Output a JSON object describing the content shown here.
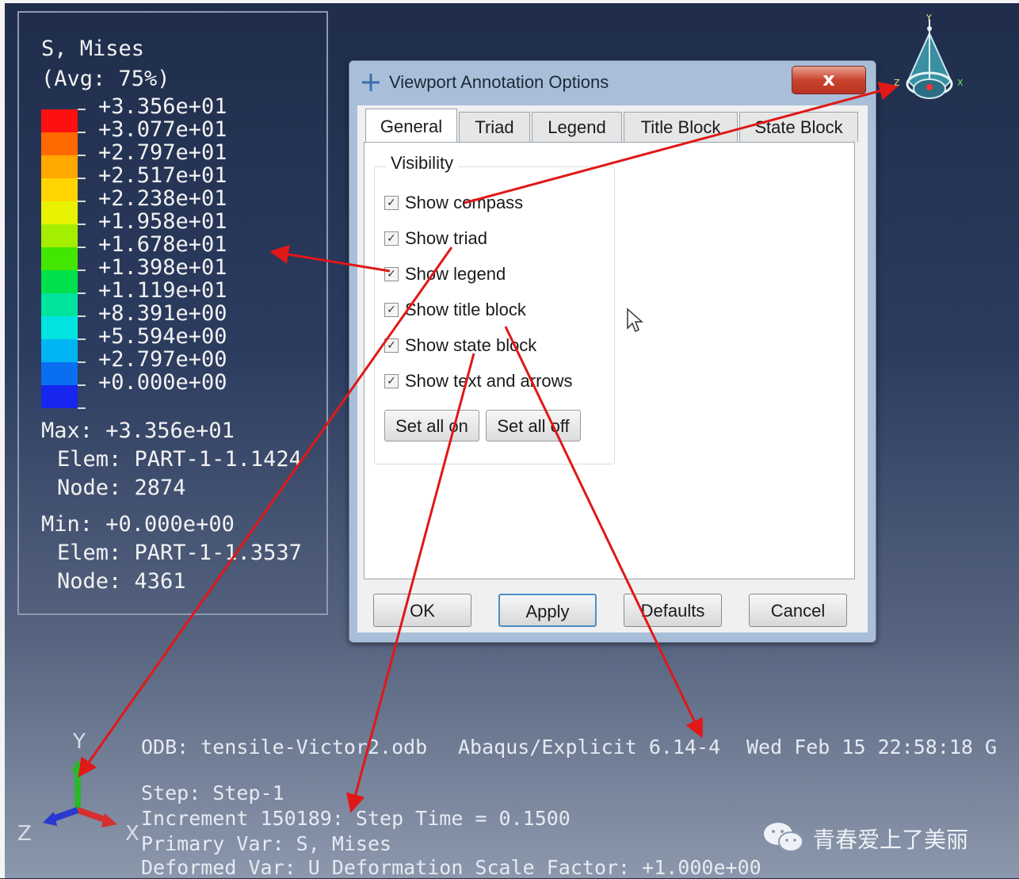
{
  "legend": {
    "title_line1": "S, Mises",
    "title_line2": "(Avg: 75%)",
    "values": [
      "+3.356e+01",
      "+3.077e+01",
      "+2.797e+01",
      "+2.517e+01",
      "+2.238e+01",
      "+1.958e+01",
      "+1.678e+01",
      "+1.398e+01",
      "+1.119e+01",
      "+8.391e+00",
      "+5.594e+00",
      "+2.797e+00",
      "+0.000e+00"
    ],
    "band_colors": [
      "#ff1010",
      "#ff6a00",
      "#ffa800",
      "#ffd400",
      "#e9f200",
      "#a6ee00",
      "#42e600",
      "#00e04a",
      "#00e39c",
      "#00e3e0",
      "#00b4f4",
      "#0a6ef0",
      "#1626ee"
    ],
    "max_label": "Max: +3.356e+01",
    "max_elem": "Elem: PART-1-1.1424",
    "max_node": "Node: 2874",
    "min_label": "Min: +0.000e+00",
    "min_elem": "Elem: PART-1-1.3537",
    "min_node": "Node: 4361"
  },
  "compass": {
    "axis_y": "Y",
    "axis_x": "X",
    "axis_z": "Z"
  },
  "dialog": {
    "title": "Viewport Annotation Options",
    "close_symbol": "x",
    "tabs": [
      {
        "label": "General",
        "active": true
      },
      {
        "label": "Triad",
        "active": false
      },
      {
        "label": "Legend",
        "active": false
      },
      {
        "label": "Title Block",
        "active": false
      },
      {
        "label": "State Block",
        "active": false
      }
    ],
    "group_title": "Visibility",
    "checkboxes": [
      {
        "label": "Show compass",
        "checked": true
      },
      {
        "label": "Show triad",
        "checked": true
      },
      {
        "label": "Show legend",
        "checked": true
      },
      {
        "label": "Show title block",
        "checked": true
      },
      {
        "label": "Show state block",
        "checked": true
      },
      {
        "label": "Show text and arrows",
        "checked": true
      }
    ],
    "set_all_on": "Set all on",
    "set_all_off": "Set all off",
    "buttons": {
      "ok": "OK",
      "apply": "Apply",
      "defaults": "Defaults",
      "cancel": "Cancel"
    }
  },
  "triad": {
    "y": "Y",
    "x": "X",
    "z": "Z"
  },
  "state_block": {
    "odb": "ODB: tensile-Victor2.odb",
    "solver": "Abaqus/Explicit 6.14-4",
    "date": "Wed Feb 15 22:58:18 G",
    "step": "Step: Step-1",
    "increment": "Increment    150189: Step Time =    0.1500",
    "primary_var": "Primary Var: S, Mises",
    "deformed_var": "Deformed Var: U   Deformation Scale Factor: +1.000e+00"
  },
  "watermark": {
    "text": "青春爱上了美丽"
  },
  "colors": {
    "annotation_arrow": "#e01818",
    "background_top": "#1f2d4b",
    "background_bottom": "#8c98ac"
  }
}
